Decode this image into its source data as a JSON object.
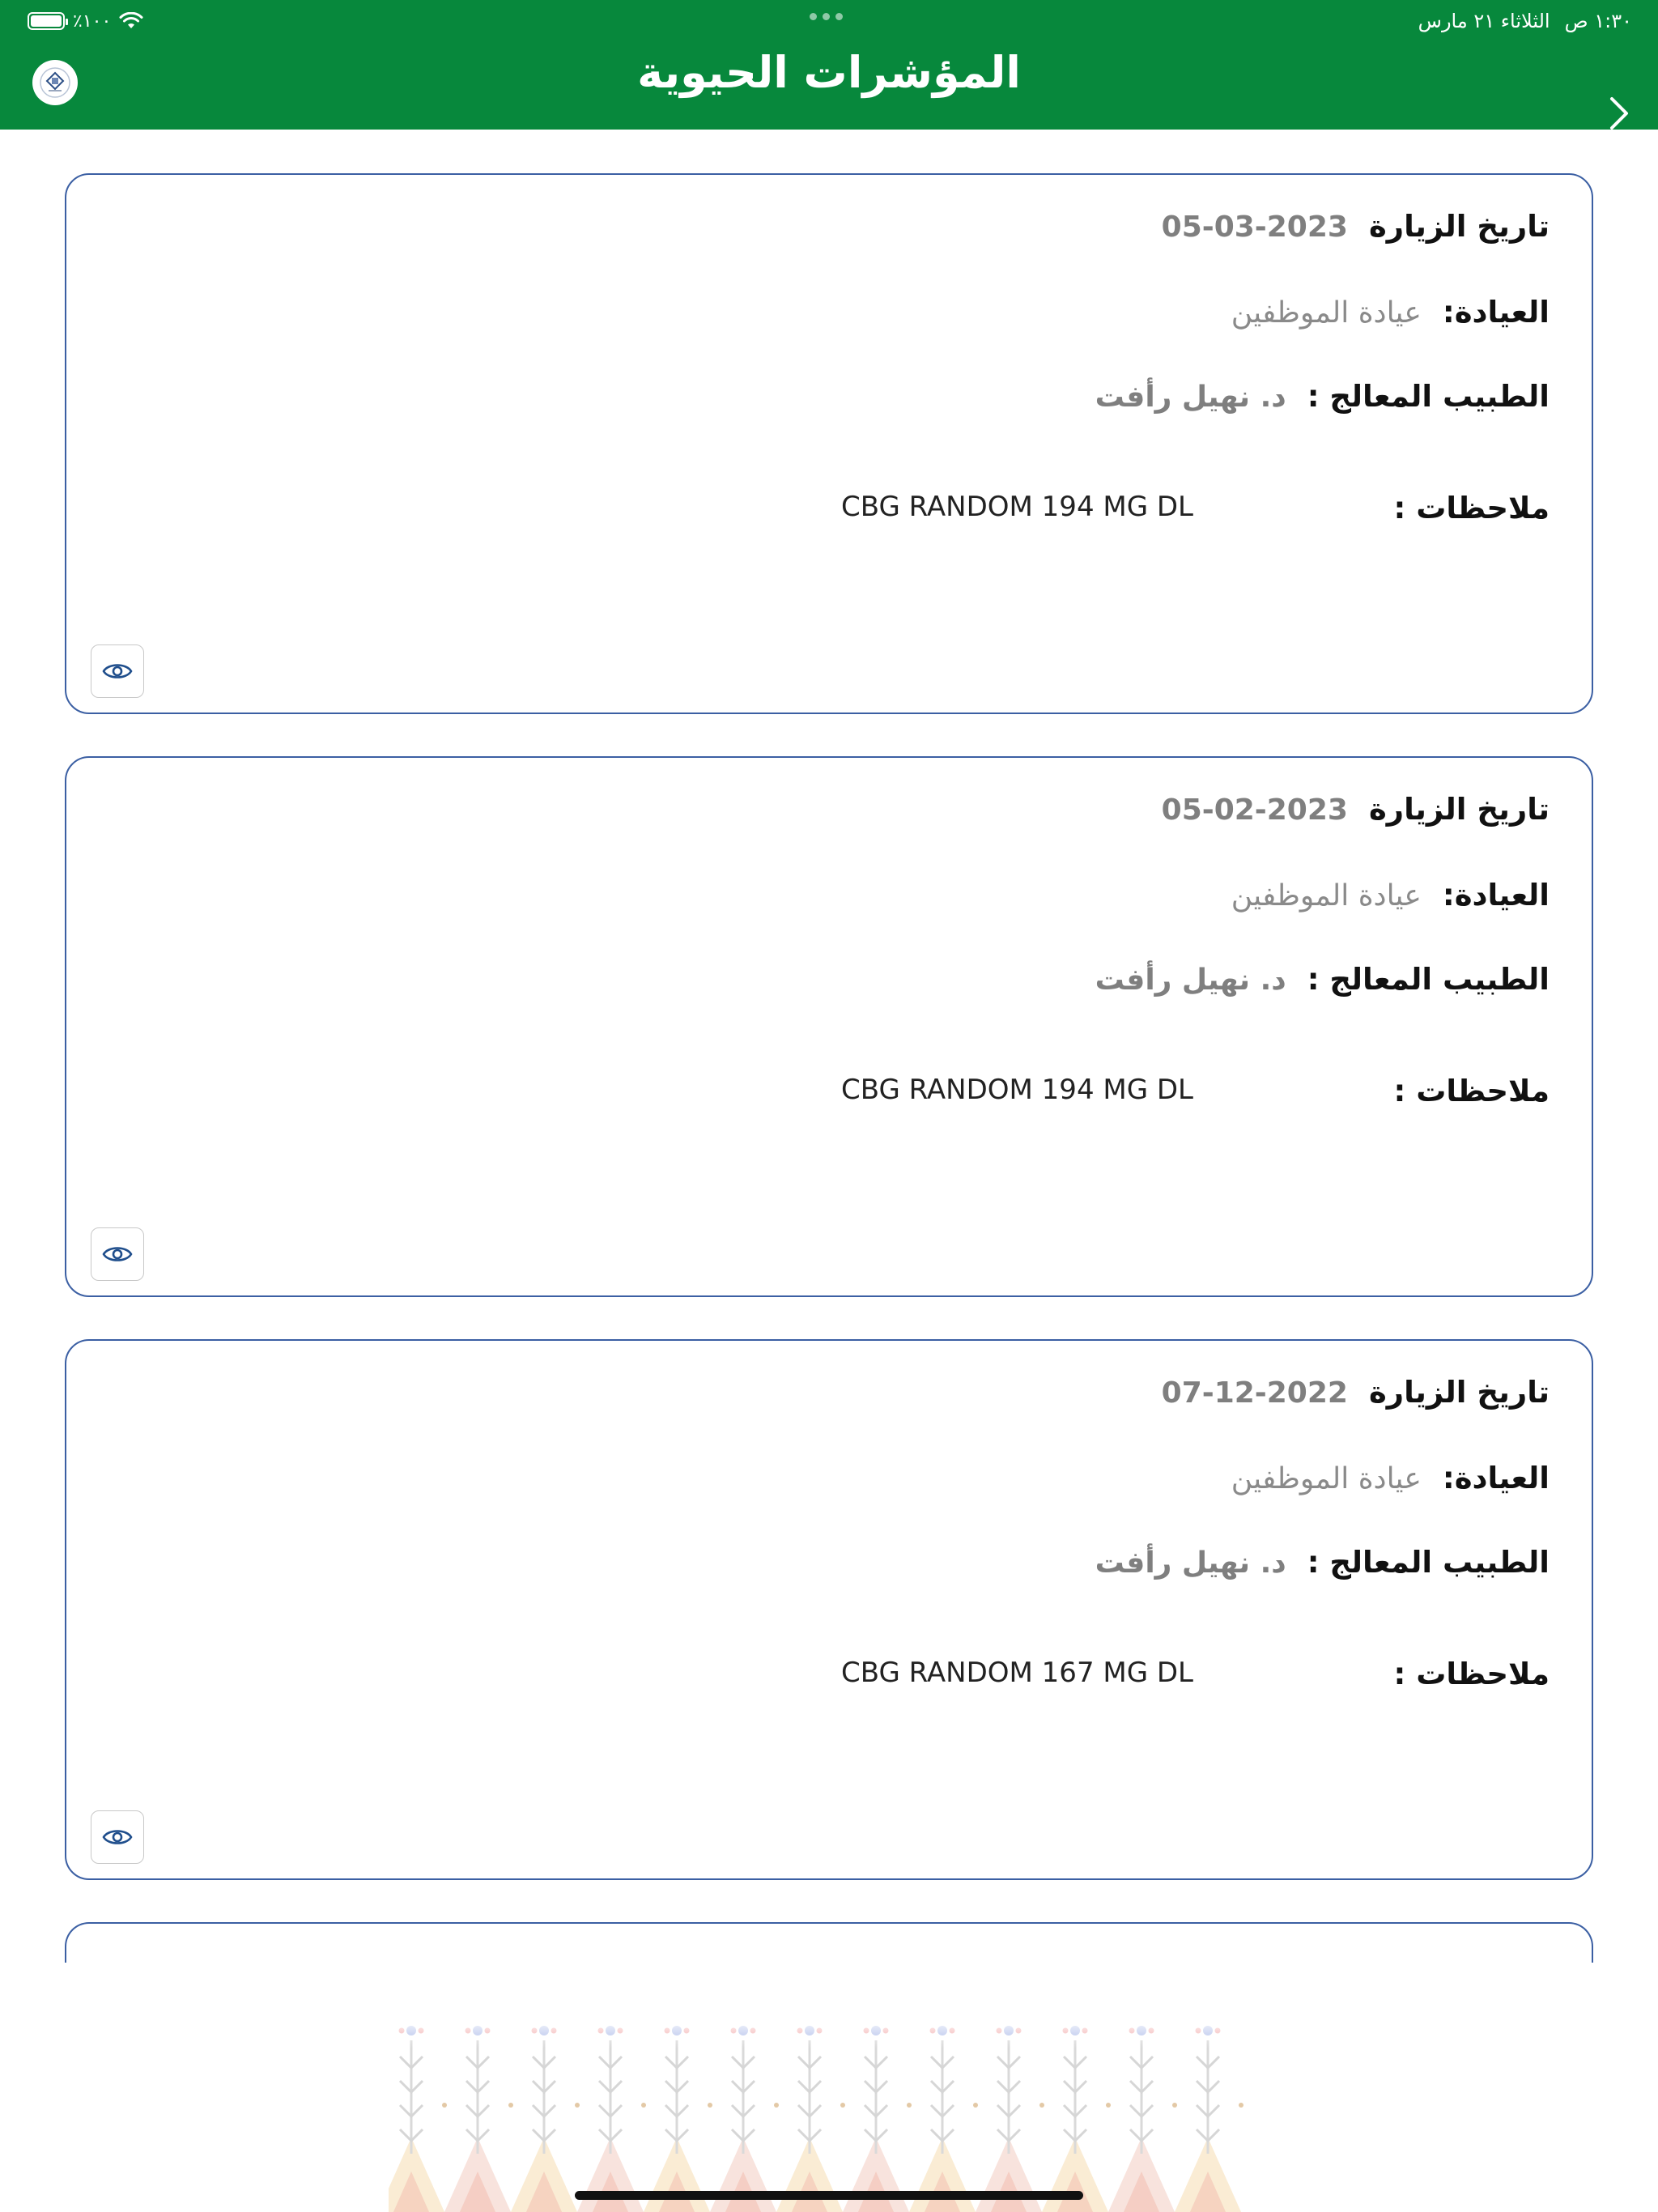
{
  "status_bar": {
    "time": "١:٣٠ ص",
    "date": "الثلاثاء ٢١ مارس",
    "battery": "٪١٠٠"
  },
  "header": {
    "title": "المؤشرات الحيوية",
    "back_icon": "chevron-right-icon",
    "logo_icon": "clinic-logo"
  },
  "labels": {
    "visit_date": "تاريخ الزيارة",
    "clinic": "العيادة:",
    "doctor": "الطبيب المعالج :",
    "notes": "ملاحظات :"
  },
  "visits": [
    {
      "date": "05-03-2023",
      "clinic": "عيادة الموظفين",
      "doctor": "د. نهيل رأفت",
      "notes": "CBG RANDOM 194 MG DL"
    },
    {
      "date": "05-02-2023",
      "clinic": "عيادة الموظفين",
      "doctor": "د. نهيل رأفت",
      "notes": "CBG RANDOM 194 MG DL"
    },
    {
      "date": "07-12-2022",
      "clinic": "عيادة الموظفين",
      "doctor": "د. نهيل رأفت",
      "notes": "CBG RANDOM 167 MG DL"
    }
  ],
  "colors": {
    "header_green": "#07883c",
    "card_border": "#3b5fa3",
    "eye_icon": "#1f4e8c"
  }
}
